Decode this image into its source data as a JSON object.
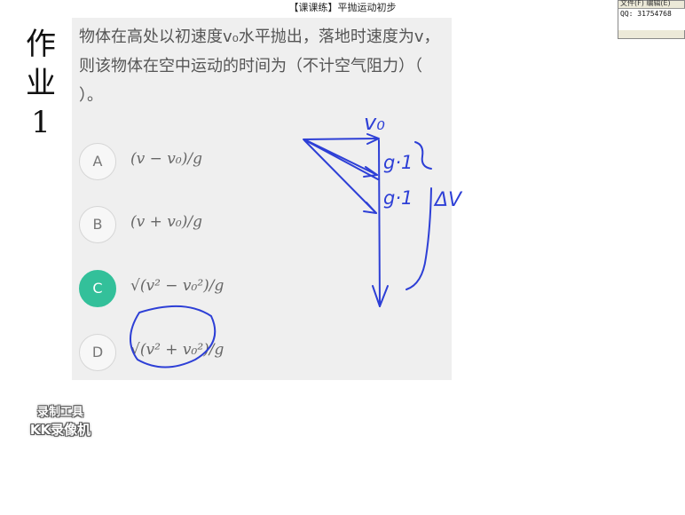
{
  "window": {
    "title": "【课课练】平抛运动初步"
  },
  "homework_label": [
    "作",
    "业",
    "1"
  ],
  "question": {
    "text": "物体在高处以初速度v₀水平抛出，落地时速度为v，则该物体在空中运动的时间为（不计空气阻力）（ ）。"
  },
  "options": [
    {
      "letter": "A",
      "formula": "(v − v₀)/g",
      "selected": false
    },
    {
      "letter": "B",
      "formula": "(v + v₀)/g",
      "selected": false
    },
    {
      "letter": "C",
      "formula": "√(v² − v₀²)/g",
      "selected": true
    },
    {
      "letter": "D",
      "formula": "√(v² + v₀²)/g",
      "selected": false
    }
  ],
  "annotations": {
    "v0": "v₀",
    "g1": "g·1",
    "g2": "g·1",
    "dv": "ΔV"
  },
  "popup": {
    "menu": "文件(F)  编辑(E)",
    "qq": "QQ: 31754768"
  },
  "watermark": {
    "line1": "录制工具",
    "line2": "KK录像机"
  },
  "colors": {
    "ink": "#2d3fd6",
    "selected": "#33c09a",
    "card": "#efefef"
  }
}
